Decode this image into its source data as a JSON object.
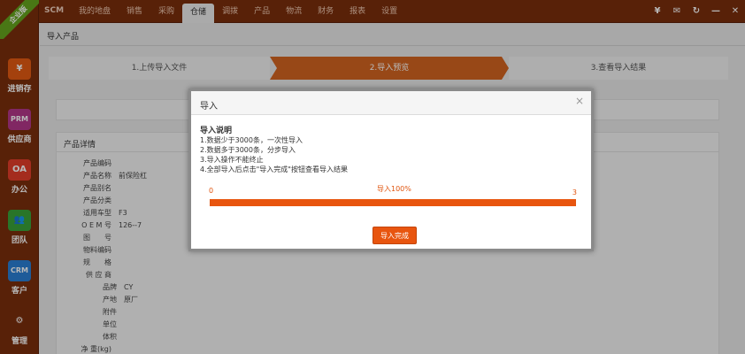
{
  "topbar": {
    "brand": "SCM",
    "nav": [
      "我的地盘",
      "销售",
      "采购",
      "仓储",
      "调拨",
      "产品",
      "物流",
      "财务",
      "报表",
      "设置"
    ],
    "active_index": 3,
    "icons": [
      "yen-icon",
      "message-icon",
      "refresh-icon",
      "minimize-icon",
      "close-icon"
    ],
    "icon_glyphs": [
      "¥",
      "✉",
      "↻",
      "—",
      "✕"
    ]
  },
  "sidebar": {
    "ribbon": "企业版",
    "items": [
      {
        "icon": "¥",
        "label": "进销存",
        "color": "#e35a12"
      },
      {
        "icon": "PRM",
        "label": "供应商",
        "color": "#b3368a"
      },
      {
        "icon": "OA",
        "label": "办公",
        "color": "#e33d2a"
      },
      {
        "icon": "👥",
        "label": "团队",
        "color": "#3aa33a"
      },
      {
        "icon": "CRM",
        "label": "客户",
        "color": "#2a7fd4"
      },
      {
        "icon": "⚙",
        "label": "管理",
        "color": "#7a2e0c"
      }
    ]
  },
  "page": {
    "title": "导入产品",
    "steps": [
      "1.上传导入文件",
      "2.导入预览",
      "3.查看导入结果"
    ],
    "active_step": 1
  },
  "details": {
    "title": "产品详情",
    "fields": [
      {
        "label": "产品编码",
        "value": ""
      },
      {
        "label": "产品名称",
        "value": "前保险杠"
      },
      {
        "label": "产品别名",
        "value": ""
      },
      {
        "label": "产品分类",
        "value": ""
      },
      {
        "label": "适用车型",
        "value": "F3"
      },
      {
        "label": "O E M 号",
        "value": "126--7"
      },
      {
        "label": "图　　号",
        "value": ""
      },
      {
        "label": "物料编码",
        "value": ""
      },
      {
        "label": "规　　格",
        "value": ""
      },
      {
        "label": "供 应 商",
        "value": ""
      }
    ],
    "sub_fields": [
      {
        "label": "品牌",
        "value": "CY"
      },
      {
        "label": "产地",
        "value": "原厂"
      },
      {
        "label": "附件",
        "value": ""
      },
      {
        "label": "单位",
        "value": ""
      },
      {
        "label": "体积",
        "value": ""
      }
    ],
    "last_field": {
      "label": "净 重(kg)",
      "value": ""
    }
  },
  "modal": {
    "title": "导入",
    "close": "×",
    "instructions_title": "导入说明",
    "instructions": [
      "1.数据少于3000条，一次性导入",
      "2.数据多于3000条，分步导入",
      "3.导入操作不能终止",
      "4.全部导入后点击\"导入完成\"按钮查看导入结果"
    ],
    "progress": {
      "start": "0",
      "end": "3",
      "label": "导入100%",
      "percent": 100
    },
    "done_button": "导入完成"
  }
}
